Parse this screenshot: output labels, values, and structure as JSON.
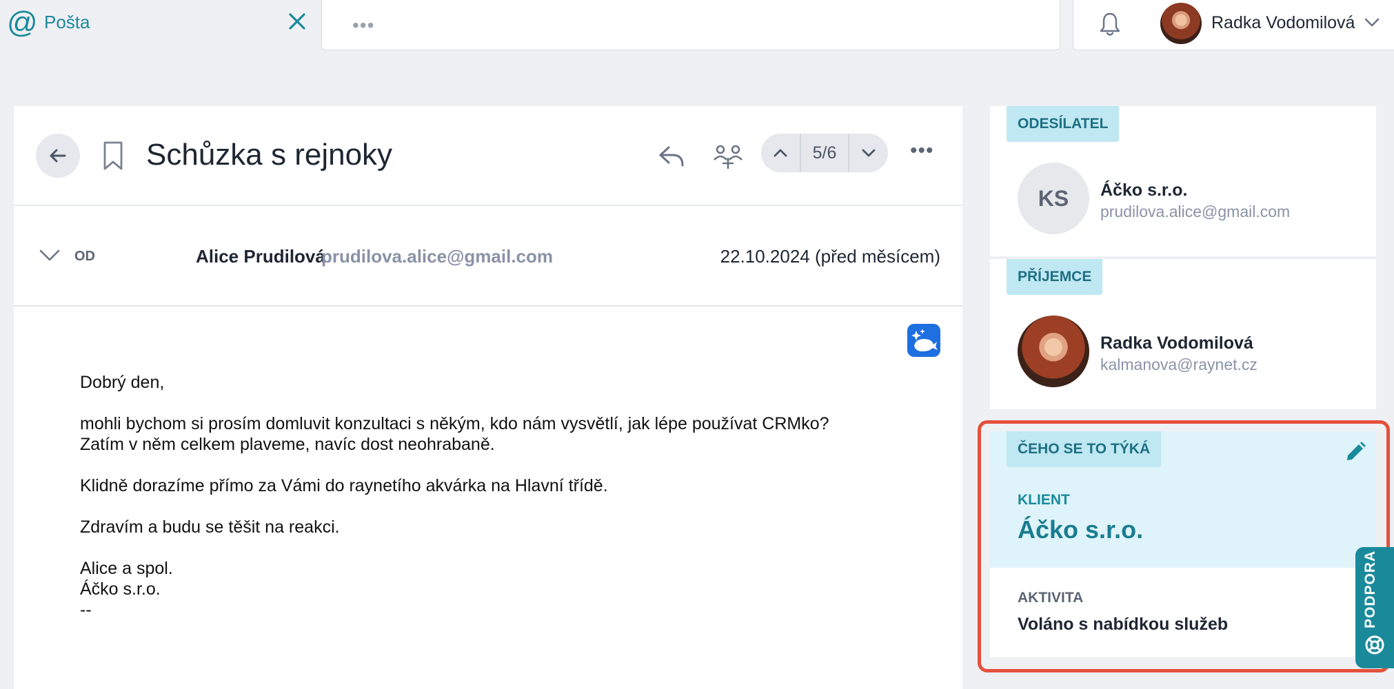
{
  "tabs": {
    "active": {
      "icon": "at-icon",
      "label": "Pošta"
    },
    "more_label": "•••"
  },
  "user": {
    "name": "Radka Vodomilová"
  },
  "email": {
    "subject": "Schůzka s rejnoky",
    "pager": "5/6",
    "more_label": "•••",
    "from_label": "OD",
    "from_name": "Alice Prudilová",
    "from_email": "prudilova.alice@gmail.com",
    "date": "22.10.2024 (před měsícem)",
    "body": [
      "Dobrý den,",
      "mohli bychom si prosím domluvit konzultaci s někým, kdo nám vysvětlí, jak lépe používat CRMko?\nZatím v něm celkem plaveme, navíc dost neohrabaně.",
      "Klidně dorazíme přímo za Vámi do raynetího akvárka na Hlavní třídě.",
      "Zdravím a budu se těšit na reakci.",
      "Alice a spol.\nÁčko s.r.o.\n--"
    ]
  },
  "sidebar": {
    "sender": {
      "heading": "ODESÍLATEL",
      "initials": "KS",
      "name": "Áčko s.r.o.",
      "email": "prudilova.alice@gmail.com"
    },
    "recipient": {
      "heading": "PŘÍJEMCE",
      "name": "Radka Vodomilová",
      "email": "kalmanova@raynet.cz"
    },
    "topic": {
      "heading": "ČEHO SE TO TÝKÁ",
      "client_label": "KLIENT",
      "client_name": "Áčko s.r.o.",
      "activity_label": "AKTIVITA",
      "activity_value": "Voláno s nabídkou služeb"
    },
    "support_label": "PODPORA"
  },
  "colors": {
    "accent": "#1a8a9b",
    "highlight": "#e4503c",
    "badge_bg": "#bfe8f2",
    "topic_bg": "#def4fa"
  }
}
